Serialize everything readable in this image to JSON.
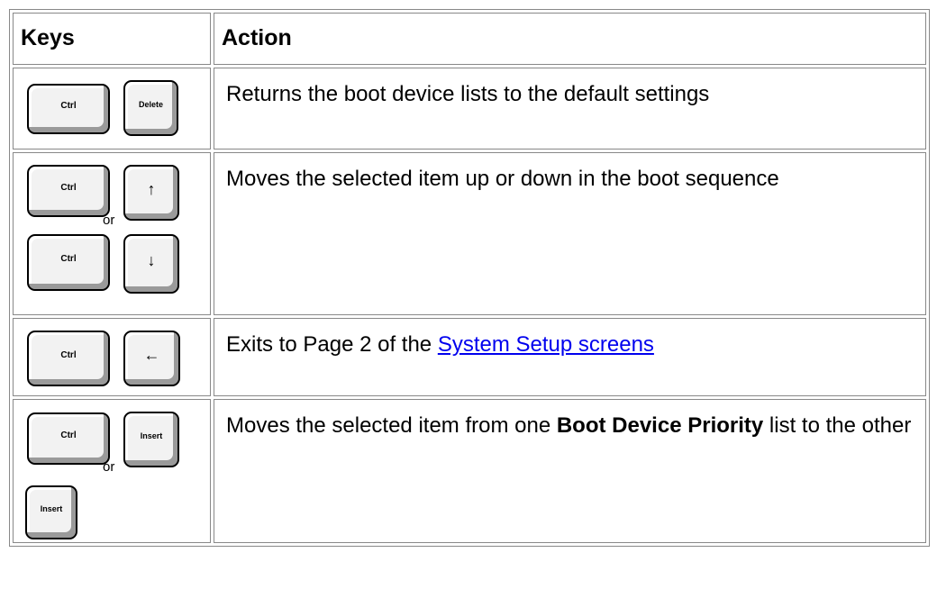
{
  "header": {
    "keys": "Keys",
    "action": "Action"
  },
  "rows": [
    {
      "keys": [
        "Ctrl",
        "Delete"
      ],
      "action": "Returns the boot device lists to the default settings"
    },
    {
      "keys": [
        "Ctrl",
        "↑",
        "Ctrl",
        "↓"
      ],
      "separator": "or",
      "action": "Moves the selected item up or down in the boot sequence"
    },
    {
      "keys": [
        "Ctrl",
        "←"
      ],
      "action_prefix": "Exits to Page 2 of the ",
      "action_link": "System Setup screens"
    },
    {
      "keys": [
        "Ctrl",
        "Insert",
        "Insert"
      ],
      "separator": "or",
      "action_prefix": "Moves the selected item from one ",
      "action_bold": "Boot Device Priority",
      "action_suffix": " list to the other"
    }
  ]
}
